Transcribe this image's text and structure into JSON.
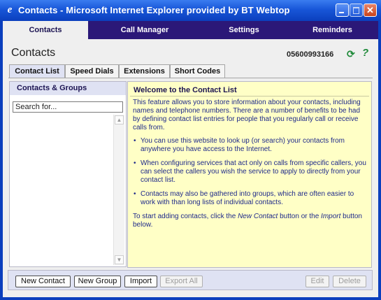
{
  "window": {
    "title": "Contacts - Microsoft Internet Explorer provided by BT Webtop",
    "icon": "ie-icon",
    "controls": [
      "minimize-icon",
      "maximize-icon",
      "close-icon"
    ]
  },
  "nav": {
    "items": [
      {
        "label": "Contacts",
        "active": true
      },
      {
        "label": "Call Manager",
        "active": false
      },
      {
        "label": "Settings",
        "active": false
      },
      {
        "label": "Reminders",
        "active": false
      }
    ]
  },
  "header": {
    "title": "Contacts",
    "phone_number": "05600993166"
  },
  "tabs": [
    {
      "label": "Contact List",
      "active": true
    },
    {
      "label": "Speed Dials",
      "active": false
    },
    {
      "label": "Extensions",
      "active": false
    },
    {
      "label": "Short Codes",
      "active": false
    }
  ],
  "left_panel": {
    "title": "Contacts & Groups",
    "search_placeholder": "Search for..."
  },
  "right_panel": {
    "title": "Welcome to the Contact List",
    "intro": "This feature allows you to store information about your contacts, including names and telephone numbers. There are a number of benefits to be had by defining contact list entries for people that you regularly call or receive calls from.",
    "bullets": [
      "You can use this website to look up (or search) your contacts from anywhere you have access to the Internet.",
      "When configuring services that act only on calls from specific callers, you can select the callers you wish the service to apply to directly from your contact list.",
      "Contacts may also be gathered into groups, which are often easier to work with than long lists of individual contacts."
    ],
    "outro_before_1": "To start adding contacts, click the ",
    "outro_em_1": "New Contact",
    "outro_middle": " button or the ",
    "outro_em_2": "Import",
    "outro_after": " button below."
  },
  "buttons": {
    "new_contact": "New Contact",
    "new_group": "New Group",
    "import": "Import",
    "export_all": "Export All",
    "edit": "Edit",
    "delete": "Delete"
  },
  "colors": {
    "title_bar": "#1856d8",
    "nav_bar": "#2b1878",
    "info_background": "#ffffc6",
    "panel_header": "#dfe2f3"
  }
}
